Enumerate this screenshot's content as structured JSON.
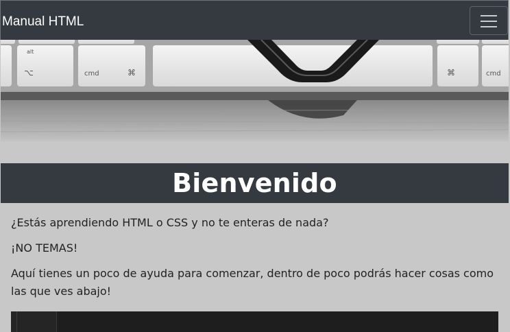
{
  "navbar": {
    "brand": "Manual HTML",
    "toggler_icon": "hamburger-menu-icon"
  },
  "hero": {
    "image_subject": "keyboard-and-glasses-photo",
    "keys": {
      "alt": "alt",
      "option": "⌥",
      "cmd_left": "cmd",
      "cmd_symbol_left": "⌘",
      "cmd_symbol_right": "⌘",
      "cmd_right": "cmd"
    }
  },
  "welcome": {
    "title": "Bienvenido"
  },
  "content": {
    "p1": "¿Estás aprendiendo HTML o CSS y no te enteras de nada?",
    "p2": "¡NO TEMAS!",
    "p3": "Aquí tienes un poco de ayuda para comenzar, dentro de poco podrás hacer cosas como las que ves abajo!"
  },
  "colors": {
    "navbar": "#343a40",
    "page_bg": "#c8c8c8",
    "welcome_bg": "#343a40",
    "code_bg": "#1e1e1e"
  }
}
